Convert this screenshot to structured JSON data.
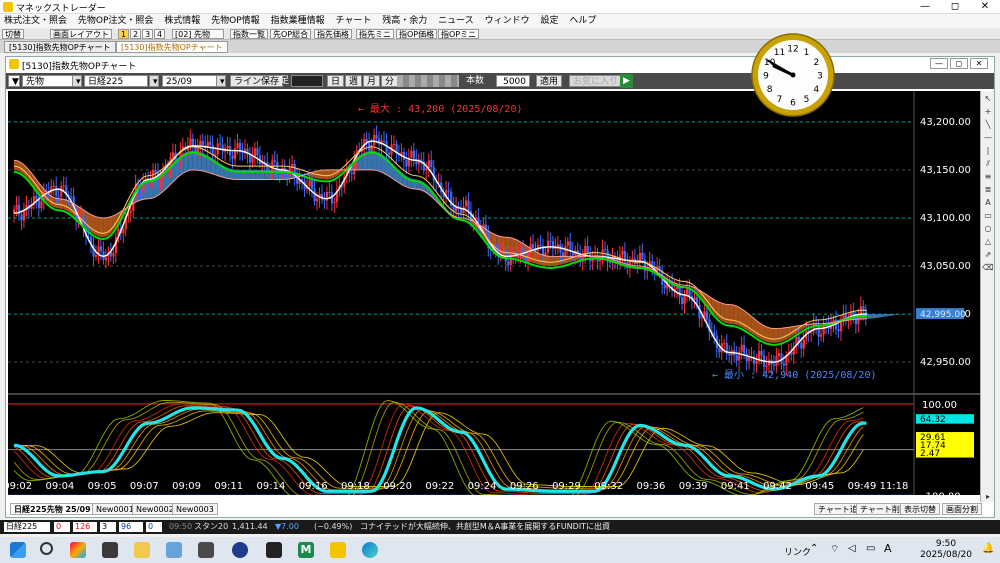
{
  "window": {
    "title": "マネックストレーダー",
    "minimize": "—",
    "maximize": "◻",
    "close": "✕"
  },
  "menu": [
    "株式注文・照会",
    "先物OP注文・照会",
    "株式情報",
    "先物OP情報",
    "指数業種情報",
    "チャート",
    "残高・余力",
    "ニュース",
    "ウィンドウ",
    "設定",
    "ヘルプ"
  ],
  "toolbar": {
    "switch": "切替",
    "layout": "画面レイアウト",
    "pages": [
      "1",
      "2",
      "3",
      "4"
    ],
    "selector": "[02] 先物",
    "buttons": [
      "指数一覧",
      "先OP総合",
      "指先価格",
      "指先ミニ",
      "指OP価格",
      "指OPミニ"
    ]
  },
  "tabs": [
    "[5130]指数先物OPチャート",
    "[5130]指数先物OPチャート"
  ],
  "chartwin": {
    "title": "[5130]指数先物OPチャート",
    "minimize": "—",
    "maximize": "◻",
    "close": "✕"
  },
  "controls": {
    "type": "先物",
    "index": "日経225",
    "month": "25/09",
    "save": "ライン保存",
    "foot_label": "足",
    "periods": [
      "日",
      "週",
      "月",
      "分"
    ],
    "count_label": "本数",
    "count": "5000",
    "apply": "適用",
    "extra": "お気に入り"
  },
  "chart_data": [
    {
      "type": "candlestick",
      "x": [
        "09:02",
        "09:04",
        "09:05",
        "09:07",
        "09:09",
        "09:11",
        "09:14",
        "09:16",
        "09:18",
        "09:20",
        "09:22",
        "09:24",
        "09:26",
        "09:29",
        "09:32",
        "09:36",
        "09:39",
        "09:41",
        "09:42",
        "09:45",
        "09:49",
        "11:18"
      ],
      "series": [
        {
          "values": [
            43105,
            43130,
            43060,
            43140,
            43175,
            43170,
            43150,
            43120,
            43180,
            43160,
            43110,
            43060,
            43070,
            43060,
            43055,
            43020,
            42960,
            42950,
            42985,
            43000,
            43000
          ]
        },
        {
          "values": [
            43150,
            43110,
            43080,
            43140,
            43170,
            43150,
            43150,
            43140,
            43170,
            43140,
            43100,
            43060,
            43050,
            43060,
            43050,
            43030,
            42990,
            42970,
            42990,
            43000,
            43000
          ]
        },
        {
          "values": [
            43160,
            43120,
            43100,
            43120,
            43150,
            43140,
            43140,
            43150,
            43150,
            43130,
            43100,
            43080,
            43060,
            43060,
            43050,
            43030,
            43010,
            42985,
            42990,
            42995,
            43000
          ]
        }
      ],
      "ylim": [
        42920,
        43230
      ],
      "yticks": [
        42950,
        43000,
        43050,
        43100,
        43150,
        43200
      ],
      "ytick_labels": [
        "42,950.00",
        "43,000.00",
        "43,050.00",
        "43,100.00",
        "43,150.00",
        "43,200.00"
      ],
      "annotations": {
        "high": "← 最大 : 43,200 (2025/08/20)",
        "low": "← 最小 : 42,940 (2025/08/20)"
      },
      "current_price_label": "42,995.00"
    },
    {
      "type": "line",
      "ylim": [
        -130,
        115
      ],
      "yticks": [
        100,
        -100
      ],
      "ytick_labels": [
        "100.00",
        "-100.00"
      ],
      "bottom_label": "-130.22",
      "series": [
        {
          "values": [
            10,
            -60,
            -50,
            60,
            95,
            90,
            -20,
            -95,
            -95,
            95,
            40,
            -90,
            -95,
            -95,
            55,
            10,
            -60,
            -90,
            -60,
            60,
            90,
            75
          ]
        }
      ],
      "value_labels": [
        "64.32",
        "29.61",
        "17.74",
        "2.47"
      ],
      "value_label_colors": [
        "#00e5e5",
        "#ffff00",
        "#ffff00",
        "#ffff00"
      ]
    }
  ],
  "bottomtabs": {
    "left": [
      "日経225先物 25/09",
      "New0001",
      "New0002",
      "New0003"
    ],
    "right": [
      "チャート追加",
      "チャート削除",
      "表示切替",
      "画面分割"
    ]
  },
  "ticker": {
    "name": "日経225",
    "v1": "0",
    "v2": "126",
    "v3": "3",
    "v4": "96",
    "v5": "0",
    "time": "09:50",
    "stan": "スタン20",
    "val": "1,411.44",
    "change": "▼7.00",
    "pct": "(−0.49%)",
    "news": "コナイテッドが大幅続伸、共創型M＆A事業を展開するFUNDITに出資"
  },
  "taskbar": {
    "link": "リンク",
    "time": "9:50",
    "date": "2025/08/20",
    "ime": "A",
    "apps": [
      "M"
    ]
  },
  "clock": {
    "hour": 9,
    "minute": 50
  }
}
